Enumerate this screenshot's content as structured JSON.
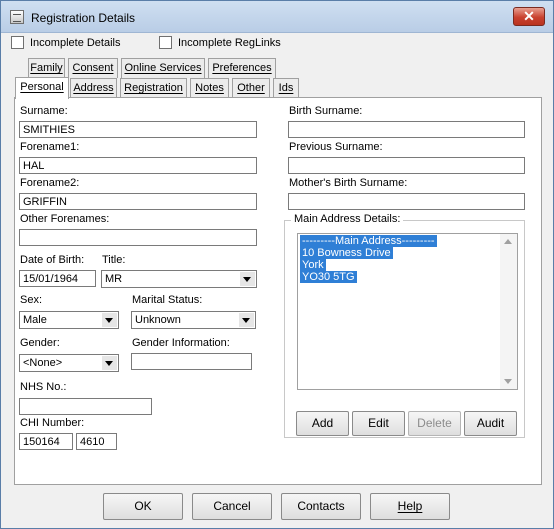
{
  "window": {
    "title": "Registration Details",
    "close_glyph": "✕"
  },
  "checkboxes": [
    {
      "label": "Incomplete Details",
      "checked": false
    },
    {
      "label": "Incomplete RegLinks",
      "checked": false
    }
  ],
  "tabs_row1": [
    "Family",
    "Consent",
    "Online Services",
    "Preferences"
  ],
  "tabs_row2": [
    "Personal",
    "Address",
    "Registration",
    "Notes",
    "Other",
    "Ids"
  ],
  "active_tab": "Personal",
  "fields": {
    "surname": {
      "label": "Surname:",
      "value": "SMITHIES"
    },
    "forename1": {
      "label": "Forename1:",
      "value": "HAL"
    },
    "forename2": {
      "label": "Forename2:",
      "value": "GRIFFIN"
    },
    "other_forenames": {
      "label": "Other Forenames:",
      "value": ""
    },
    "dob": {
      "label": "Date of Birth:",
      "value": "15/01/1964"
    },
    "title": {
      "label": "Title:",
      "value": "MR"
    },
    "sex": {
      "label": "Sex:",
      "value": "Male"
    },
    "marital_status": {
      "label": "Marital Status:",
      "value": "Unknown"
    },
    "gender": {
      "label": "Gender:",
      "value": "<None>"
    },
    "gender_information": {
      "label": "Gender Information:",
      "value": ""
    },
    "nhs_no": {
      "label": "NHS No.:",
      "value": ""
    },
    "chi_number": {
      "label": "CHI Number:",
      "part1": "150164",
      "part2": "4610"
    },
    "birth_surname": {
      "label": "Birth Surname:",
      "value": ""
    },
    "previous_surname": {
      "label": "Previous Surname:",
      "value": ""
    },
    "mothers_birth_surname": {
      "label": "Mother's Birth Surname:",
      "value": ""
    }
  },
  "main_address": {
    "legend": "Main Address Details:",
    "lines": [
      "---------Main Address---------",
      "10 Bowness Drive",
      "York",
      "YO30 5TG"
    ],
    "buttons": {
      "add": "Add",
      "edit": "Edit",
      "delete": "Delete",
      "audit": "Audit"
    }
  },
  "footer_buttons": {
    "ok": "OK",
    "cancel": "Cancel",
    "contacts": "Contacts",
    "help": "Help"
  },
  "colors": {
    "selection": "#2f7fd6",
    "close_button": "#c9412f",
    "titlebar": "#c4d6ec"
  }
}
